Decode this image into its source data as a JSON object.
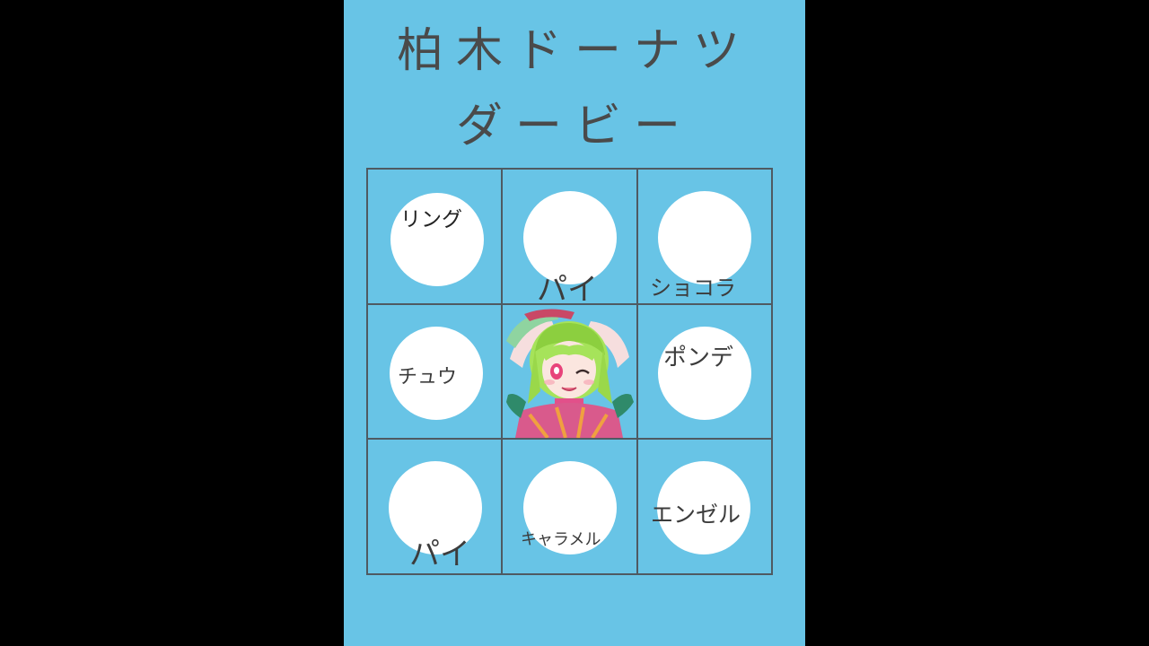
{
  "title": {
    "line1": "柏木ドーナツ",
    "line2": "ダービー"
  },
  "board": {
    "cells": [
      {
        "label": "リング"
      },
      {
        "label": "パイ"
      },
      {
        "label": "ショコラ"
      },
      {
        "label": "チュウ"
      },
      {
        "label": ""
      },
      {
        "label": "ポンデ"
      },
      {
        "label": "パイ"
      },
      {
        "label": "キャラメル"
      },
      {
        "label": "エンゼル"
      }
    ]
  },
  "colors": {
    "background": "#000000",
    "panel": "#68c4e6",
    "grid_line": "#4f5a62",
    "circle": "#ffffff",
    "text": "#4a4a4a"
  }
}
